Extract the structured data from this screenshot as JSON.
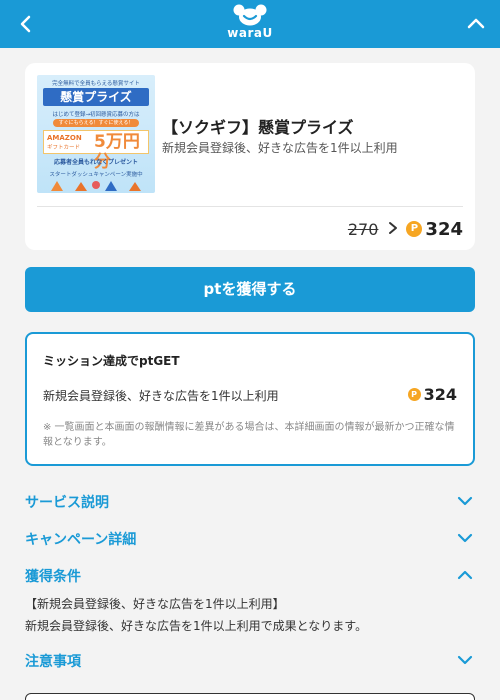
{
  "header": {
    "logo_text": "waraU",
    "back_icon": "chevron-left-icon",
    "collapse_icon": "chevron-up-icon",
    "background": "#1a9ad6"
  },
  "offer": {
    "banner": {
      "top_text": "完全無料で全員もらえる懸賞サイト",
      "title": "懸賞プライズ",
      "subtitle": "はじめて登録→初回懸賞応募の方は",
      "pill": "すぐにもらえる！すぐに使える！",
      "gift_brand": "AMAZON",
      "gift_card": "ギフトカード",
      "amount": "5万円分",
      "note": "応募者全員もれなくプレゼント",
      "start": "スタートダッシュキャンペーン実施中"
    },
    "title": "【ソクギフ】懸賞プライズ",
    "description": "新規会員登録後、好きな広告を1件以上利用",
    "old_points": "270",
    "coin_symbol": "P",
    "new_points": "324"
  },
  "cta": {
    "label": "ptを獲得する"
  },
  "mission": {
    "title": "ミッション達成でptGET",
    "description": "新規会員登録後、好きな広告を1件以上利用",
    "points": "324",
    "note": "※ 一覧画面と本画面の報酬情報に差異がある場合は、本詳細画面の情報が最新かつ正確な情報となります。"
  },
  "sections": {
    "service": "サービス説明",
    "campaign": "キャンペーン詳細",
    "condition": "獲得条件",
    "notes": "注意事項"
  },
  "condition_detail": {
    "line1": "【新規会員登録後、好きな広告を1件以上利用】",
    "line2": "新規会員登録後、好きな広告を1件以上利用で成果となります。"
  },
  "colors": {
    "accent": "#1a9ad6",
    "coin": "#f6a623",
    "background": "#f3f3f3"
  }
}
